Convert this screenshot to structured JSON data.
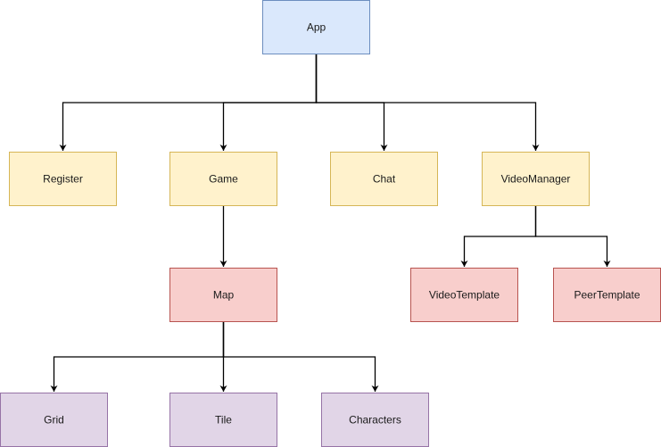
{
  "diagram": {
    "type": "tree",
    "colors": {
      "blue": {
        "fill": "#dae8fc",
        "stroke": "#6c8ebf"
      },
      "yellow": {
        "fill": "#fff2cc",
        "stroke": "#d6b656"
      },
      "red": {
        "fill": "#f8cecc",
        "stroke": "#b85450"
      },
      "purple": {
        "fill": "#e1d5e7",
        "stroke": "#9673a6"
      },
      "edge": "#000000"
    },
    "nodes": [
      {
        "id": "app",
        "label": "App",
        "color": "blue"
      },
      {
        "id": "register",
        "label": "Register",
        "color": "yellow"
      },
      {
        "id": "game",
        "label": "Game",
        "color": "yellow"
      },
      {
        "id": "chat",
        "label": "Chat",
        "color": "yellow"
      },
      {
        "id": "videomanager",
        "label": "VideoManager",
        "color": "yellow"
      },
      {
        "id": "map",
        "label": "Map",
        "color": "red"
      },
      {
        "id": "videotemplate",
        "label": "VideoTemplate",
        "color": "red"
      },
      {
        "id": "peertemplate",
        "label": "PeerTemplate",
        "color": "red"
      },
      {
        "id": "grid",
        "label": "Grid",
        "color": "purple"
      },
      {
        "id": "tile",
        "label": "Tile",
        "color": "purple"
      },
      {
        "id": "characters",
        "label": "Characters",
        "color": "purple"
      }
    ],
    "edges": [
      {
        "from": "app",
        "to": "register"
      },
      {
        "from": "app",
        "to": "game"
      },
      {
        "from": "app",
        "to": "chat"
      },
      {
        "from": "app",
        "to": "videomanager"
      },
      {
        "from": "game",
        "to": "map"
      },
      {
        "from": "videomanager",
        "to": "videotemplate"
      },
      {
        "from": "videomanager",
        "to": "peertemplate"
      },
      {
        "from": "map",
        "to": "grid"
      },
      {
        "from": "map",
        "to": "tile"
      },
      {
        "from": "map",
        "to": "characters"
      }
    ]
  }
}
